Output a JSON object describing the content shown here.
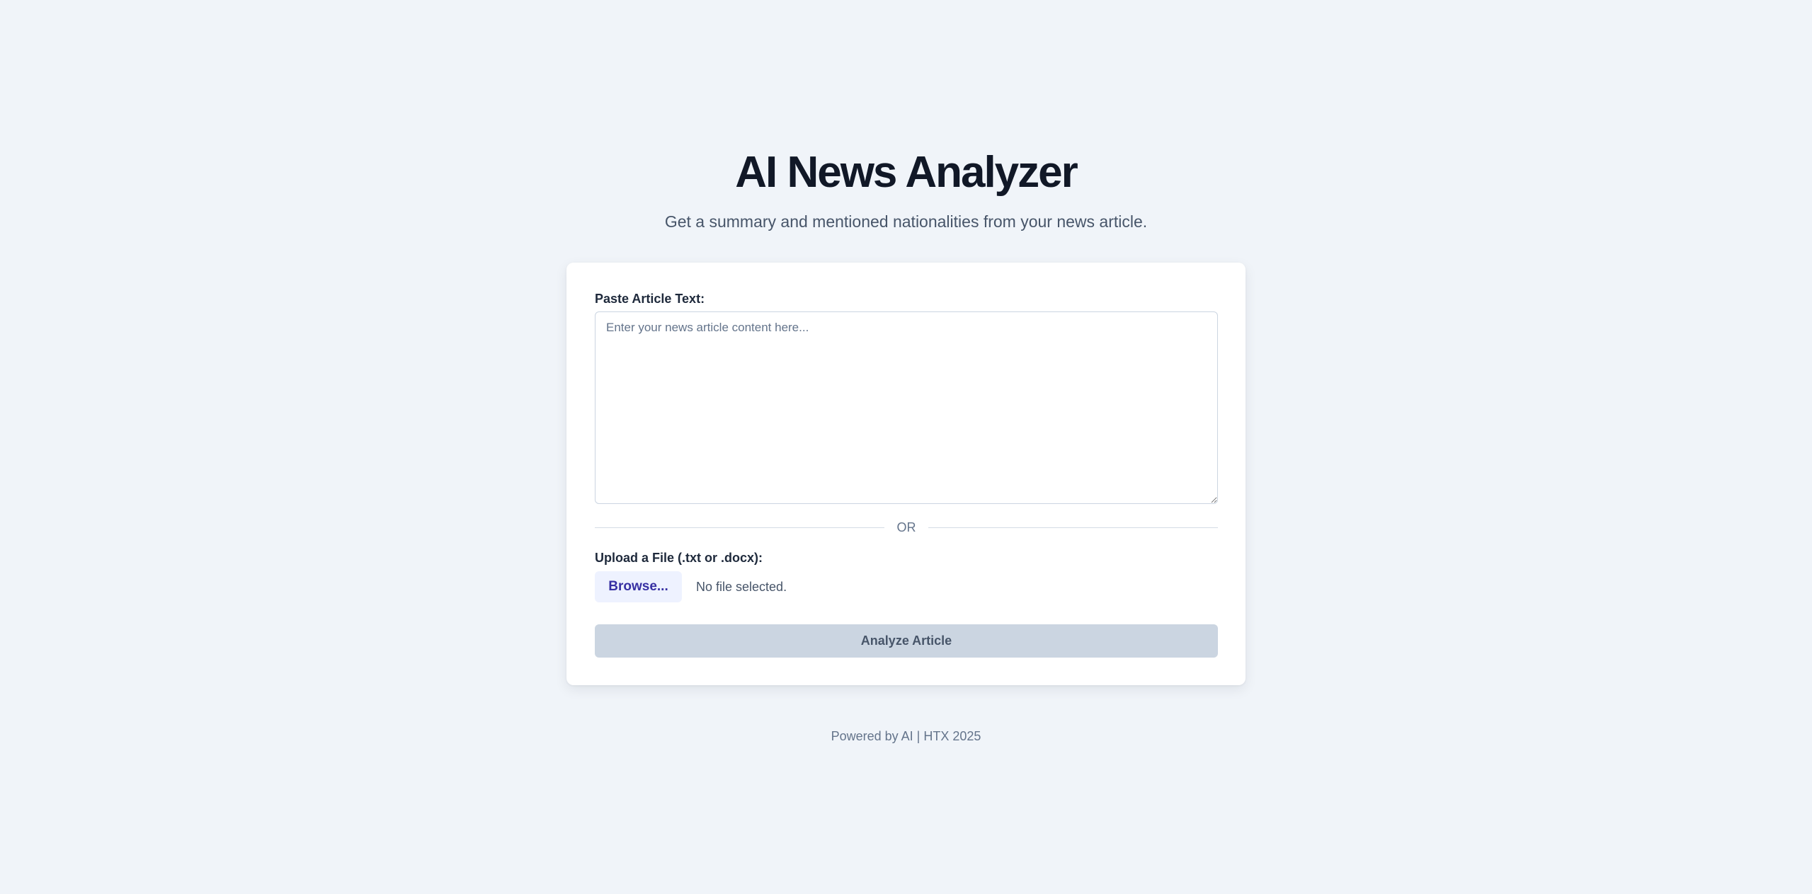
{
  "header": {
    "title": "AI News Analyzer",
    "subtitle": "Get a summary and mentioned nationalities from your news article."
  },
  "form": {
    "text_label": "Paste Article Text:",
    "text_value": "",
    "text_placeholder": "Enter your news article content here...",
    "divider_label": "OR",
    "file_label": "Upload a File (.txt or .docx):",
    "browse_label": "Browse...",
    "file_status": "No file selected.",
    "analyze_label": "Analyze Article",
    "analyze_enabled": false
  },
  "footer": {
    "text": "Powered by AI | HTX 2025"
  },
  "colors": {
    "background": "#f0f4f9",
    "card": "#ffffff",
    "title": "#111827",
    "browse_bg": "#eef2ff",
    "browse_text": "#3730a3",
    "button_disabled": "#cbd5e1"
  }
}
